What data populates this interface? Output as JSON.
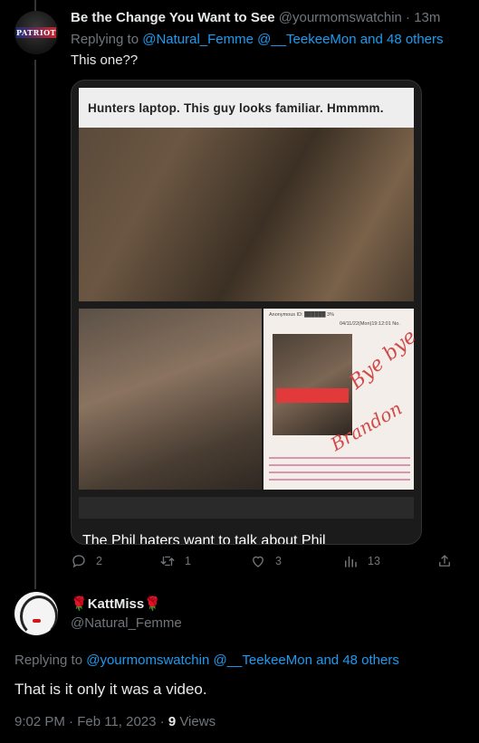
{
  "tweet1": {
    "avatar_text": "PATRIOT",
    "display_name": "Be the Change You Want to See",
    "handle": "@yourmomswatchin",
    "separator": "·",
    "time": "13m",
    "replying_prefix": "Replying to ",
    "replying_mentions": "@Natural_Femme @__TeekeeMon",
    "replying_suffix": " and 48 others",
    "text": "This one??",
    "media": {
      "header_text": "Hunters laptop. This guy looks familiar. Hmmmm.",
      "inner_header": "Anonymous ID: ██████ 3%",
      "inner_date": "04/11/22(Mon)19:12:01 No.",
      "scrawl_1": "Bye bye",
      "scrawl_2": "Brandon",
      "caption": "The Phil haters want to talk about Phil"
    },
    "actions": {
      "replies": "2",
      "retweets": "1",
      "likes": "3",
      "views": "13"
    }
  },
  "tweet2": {
    "display_name": "KattMiss",
    "name_emoji_left": "🌹",
    "name_emoji_right": "🌹",
    "handle": "@Natural_Femme",
    "replying_prefix": "Replying to ",
    "replying_mentions": "@yourmomswatchin @__TeekeeMon",
    "replying_suffix": " and 48 others",
    "text": "That is it only it was a video.",
    "timestamp": "9:02 PM · Feb 11, 2023 · ",
    "views_count": "9",
    "views_label": " Views"
  },
  "colors": {
    "background": "#000000",
    "text": "#e7e9ea",
    "muted": "#71767b",
    "link": "#1d9bf0"
  }
}
